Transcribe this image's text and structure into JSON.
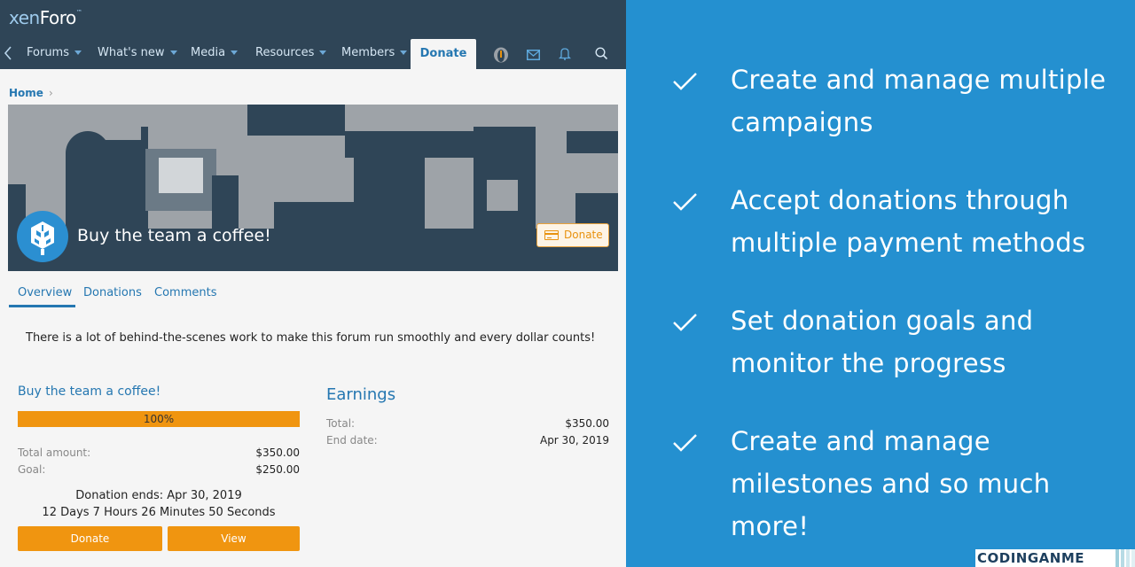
{
  "header": {
    "logo_prefix": "xen",
    "logo_suffix": "Foro",
    "logo_mark": "™",
    "nav": [
      {
        "label": "Forums",
        "has_caret": true
      },
      {
        "label": "What's new",
        "has_caret": true
      },
      {
        "label": "Media",
        "has_caret": true
      },
      {
        "label": "Resources",
        "has_caret": true
      },
      {
        "label": "Members",
        "has_caret": true
      }
    ],
    "active_tab": "Donate",
    "icons": [
      "back-chevron-icon",
      "avatar-icon",
      "envelope-icon",
      "bell-icon",
      "search-icon"
    ]
  },
  "breadcrumb": {
    "home": "Home",
    "separator": "›"
  },
  "banner": {
    "title": "Buy the team a coffee!",
    "donate_button": "Donate",
    "avatar_icon": "xenforo-cube-icon",
    "button_icon": "credit-card-icon"
  },
  "tabs": [
    {
      "label": "Overview",
      "active": true
    },
    {
      "label": "Donations",
      "active": false
    },
    {
      "label": "Comments",
      "active": false
    }
  ],
  "description": "There is a lot of behind-the-scenes work to make this forum run smoothly and every dollar counts!",
  "campaign": {
    "title": "Buy the team a coffee!",
    "progress_percent": 100,
    "progress_label": "100%",
    "total_amount_label": "Total amount:",
    "total_amount_value": "$350.00",
    "goal_label": "Goal:",
    "goal_value": "$250.00",
    "ends_text": "Donation ends: Apr 30, 2019",
    "countdown": "12 Days 7 Hours 26 Minutes 50 Seconds",
    "donate_button": "Donate",
    "view_button": "View"
  },
  "earnings": {
    "title": "Earnings",
    "total_label": "Total:",
    "total_value": "$350.00",
    "end_date_label": "End date:",
    "end_date_value": "Apr 30, 2019"
  },
  "features": [
    {
      "line1": "Create and manage multiple",
      "line2": "campaigns"
    },
    {
      "line1": "Accept donations through",
      "line2": "multiple payment methods"
    },
    {
      "line1": "Set donation goals and",
      "line2": "monitor the progress"
    },
    {
      "line1": "Create and manage",
      "line2": "milestones and so much more!"
    }
  ],
  "watermark": "CODINGANME",
  "colors": {
    "header_bg": "#2f4557",
    "link_blue": "#2577b1",
    "accent_orange": "#f09510",
    "panel_blue": "#2490d0"
  }
}
